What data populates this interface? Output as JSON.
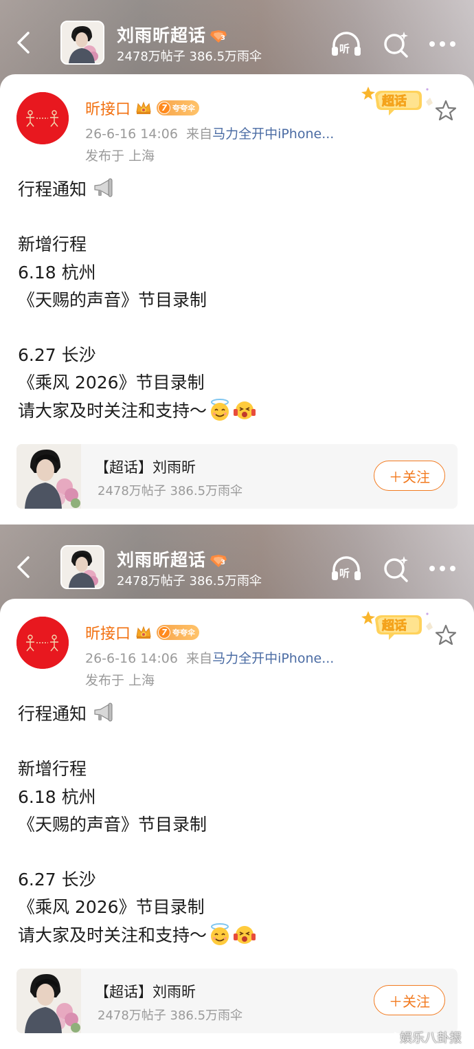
{
  "header": {
    "title": "刘雨昕超话",
    "stats": "2478万帖子 386.5万雨伞"
  },
  "post": {
    "author": "昕接口",
    "fan_label": "夸夸伞",
    "fan_level": "7",
    "supertopic_badge": "超话",
    "time": "26-6-16 14:06",
    "source_prefix": "来自",
    "source": "马力全开中iPhone...",
    "location": "发布于 上海",
    "lines": [
      "行程通知",
      "",
      "新增行程",
      "6.18 杭州",
      "《天赐的声音》节目录制",
      "",
      "6.27 长沙",
      "《乘风 2026》节目录制",
      "请大家及时关注和支持～"
    ]
  },
  "topic_card": {
    "title": "【超话】刘雨昕",
    "stats": "2478万帖子 386.5万雨伞",
    "follow_label": "＋关注"
  },
  "watermark": "娱乐八卦报",
  "colors": {
    "accent": "#f26f0e",
    "link": "#4a6ba3",
    "avatar_bg": "#e8181f"
  }
}
